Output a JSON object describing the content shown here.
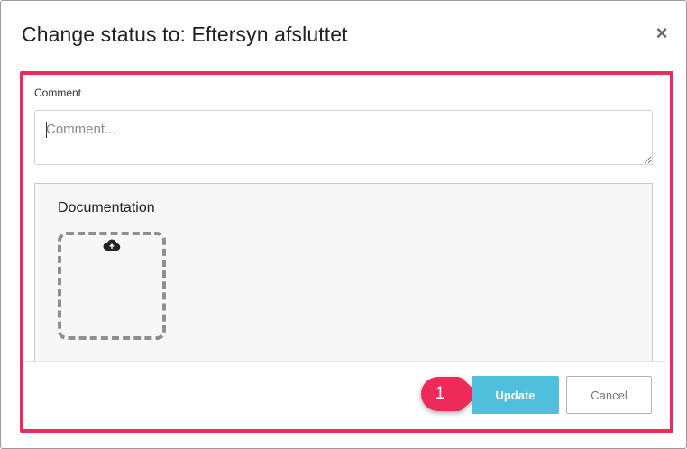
{
  "dialog": {
    "title": "Change status to: Eftersyn afsluttet",
    "close_glyph": "×",
    "close_icon": "close-icon"
  },
  "comment": {
    "label": "Comment",
    "placeholder": "Comment...",
    "value": ""
  },
  "documentation": {
    "title": "Documentation",
    "upload_icon": "cloud-upload-icon"
  },
  "footer": {
    "step_badge": "1",
    "update_label": "Update",
    "cancel_label": "Cancel"
  },
  "colors": {
    "highlight": "#ee2a5b",
    "update_button": "#4fbfdb",
    "badge": "#ee2a5b"
  }
}
